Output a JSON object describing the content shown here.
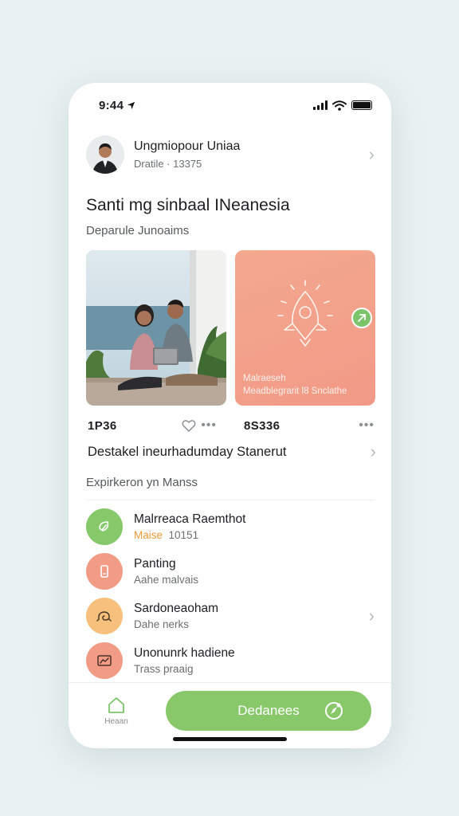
{
  "status_bar": {
    "time": "9:44"
  },
  "profile": {
    "name": "Ungmiopour Uniaa",
    "meta": "Dratile · 13375"
  },
  "header": {
    "title": "Santi mg sinbaal INeanesia",
    "subtitle": "Deparule Junoaims"
  },
  "promo_card": {
    "line1": "Malraeseh",
    "line2": "Meadblegrarit l8 Snclathe"
  },
  "stats": [
    {
      "value": "1P36"
    },
    {
      "value": "8S336"
    }
  ],
  "feature_link": {
    "label": "Destakel ineurhadumday Stanerut"
  },
  "section": {
    "title": "Expirkeron yn Manss"
  },
  "list": [
    {
      "title": "Malrreaca Raemthot",
      "sub_accent": "Maise",
      "sub_rest": "10151",
      "icon": "leaf-icon",
      "color": "#86c96a"
    },
    {
      "title": "Panting",
      "sub": "Aahe malvais",
      "icon": "phone-icon",
      "color": "#f29c86"
    },
    {
      "title": "Sardoneaoham",
      "sub": "Dahe nerks",
      "icon": "shell-icon",
      "color": "#f7c07c"
    },
    {
      "title": "Unonunrk hadiene",
      "sub": "Trass praaig",
      "icon": "chart-icon",
      "color": "#f29c86"
    }
  ],
  "tabbar": {
    "home_label": "Heaan",
    "cta_label": "Dedanees"
  },
  "colors": {
    "accent_green": "#88c86b",
    "coral": "#f29c86",
    "orange": "#f19a38"
  }
}
